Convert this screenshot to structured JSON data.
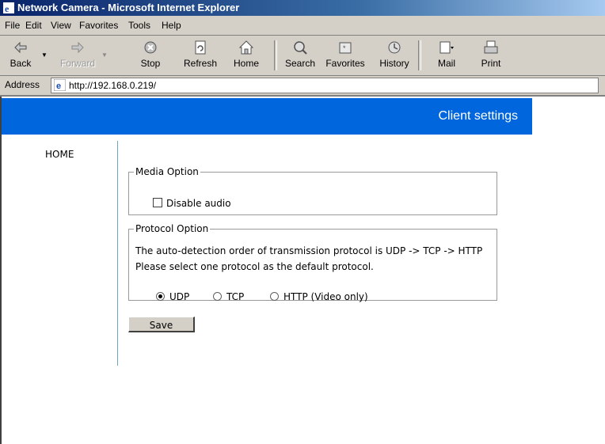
{
  "window": {
    "title": "Network Camera - Microsoft Internet Explorer"
  },
  "menu": {
    "items": [
      "File",
      "Edit",
      "View",
      "Favorites",
      "Tools",
      "Help"
    ]
  },
  "toolbar": {
    "back": "Back",
    "forward": "Forward",
    "stop": "Stop",
    "refresh": "Refresh",
    "home": "Home",
    "search": "Search",
    "favorites": "Favorites",
    "history": "History",
    "mail": "Mail",
    "print": "Print"
  },
  "address": {
    "label": "Address",
    "url": "http://192.168.0.219/"
  },
  "page": {
    "banner_title": "Client settings",
    "nav_home": "HOME",
    "media": {
      "legend": "Media Option",
      "disable_audio_label": "Disable audio",
      "disable_audio_checked": false
    },
    "protocol": {
      "legend": "Protocol Option",
      "line1": "The auto-detection order of transmission protocol is UDP -> TCP -> HTTP",
      "line2": "Please select one protocol as the default protocol.",
      "options": [
        "UDP",
        "TCP",
        "HTTP (Video only)"
      ],
      "selected": "UDP"
    },
    "save_label": "Save"
  },
  "colors": {
    "banner": "#0066dd",
    "titlebar": "#0a246a",
    "chrome": "#d4d0c8",
    "divider": "#6aa6c4"
  }
}
